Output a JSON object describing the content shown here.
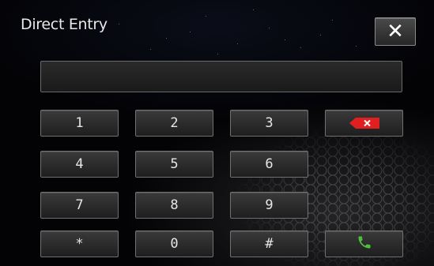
{
  "header": {
    "title": "Direct Entry",
    "close_label": "✕"
  },
  "entry": {
    "value": ""
  },
  "keypad": {
    "keys": [
      "1",
      "2",
      "3",
      "4",
      "5",
      "6",
      "7",
      "8",
      "9",
      "*",
      "0",
      "#"
    ],
    "backspace_icon": "backspace-icon",
    "call_icon": "phone-call-icon"
  },
  "colors": {
    "backspace": "#e02020",
    "call": "#4cc13a"
  }
}
